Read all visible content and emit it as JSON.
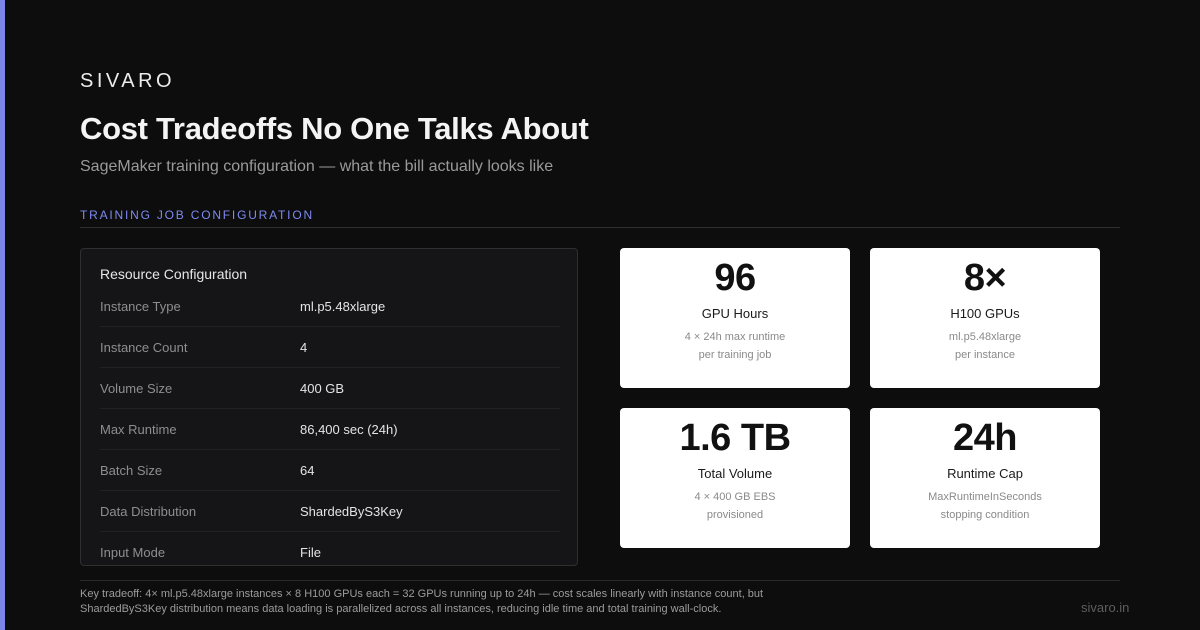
{
  "brand": "SIVARO",
  "title": "Cost Tradeoffs No One Talks About",
  "subtitle": "SageMaker training configuration — what the bill actually looks like",
  "section_label": "TRAINING JOB CONFIGURATION",
  "config": {
    "title": "Resource Configuration",
    "rows": [
      {
        "key": "Instance Type",
        "value": "ml.p5.48xlarge"
      },
      {
        "key": "Instance Count",
        "value": "4"
      },
      {
        "key": "Volume Size",
        "value": "400 GB"
      },
      {
        "key": "Max Runtime",
        "value": "86,400 sec (24h)"
      },
      {
        "key": "Batch Size",
        "value": "64"
      },
      {
        "key": "Data Distribution",
        "value": "ShardedByS3Key"
      },
      {
        "key": "Input Mode",
        "value": "File"
      }
    ]
  },
  "stats": [
    {
      "value": "96",
      "label": "GPU Hours",
      "note1": "4 × 24h max runtime",
      "note2": "per training job"
    },
    {
      "value": "8×",
      "label": "H100 GPUs",
      "note1": "ml.p5.48xlarge",
      "note2": "per instance"
    },
    {
      "value": "1.6 TB",
      "label": "Total Volume",
      "note1": "4 × 400 GB EBS",
      "note2": "provisioned"
    },
    {
      "value": "24h",
      "label": "Runtime Cap",
      "note1": "MaxRuntimeInSeconds",
      "note2": "stopping condition"
    }
  ],
  "footnote": {
    "line1": "Key tradeoff: 4× ml.p5.48xlarge instances × 8 H100 GPUs each = 32 GPUs running up to 24h — cost scales linearly with instance count, but",
    "line2": "ShardedByS3Key distribution means data loading is parallelized across all instances, reducing idle time and total training wall-clock."
  },
  "site": "sivaro.in",
  "colors": {
    "background": "#0d0d0d",
    "accent": "#7b86e6",
    "card": "#ffffff",
    "panel": "#151517"
  }
}
